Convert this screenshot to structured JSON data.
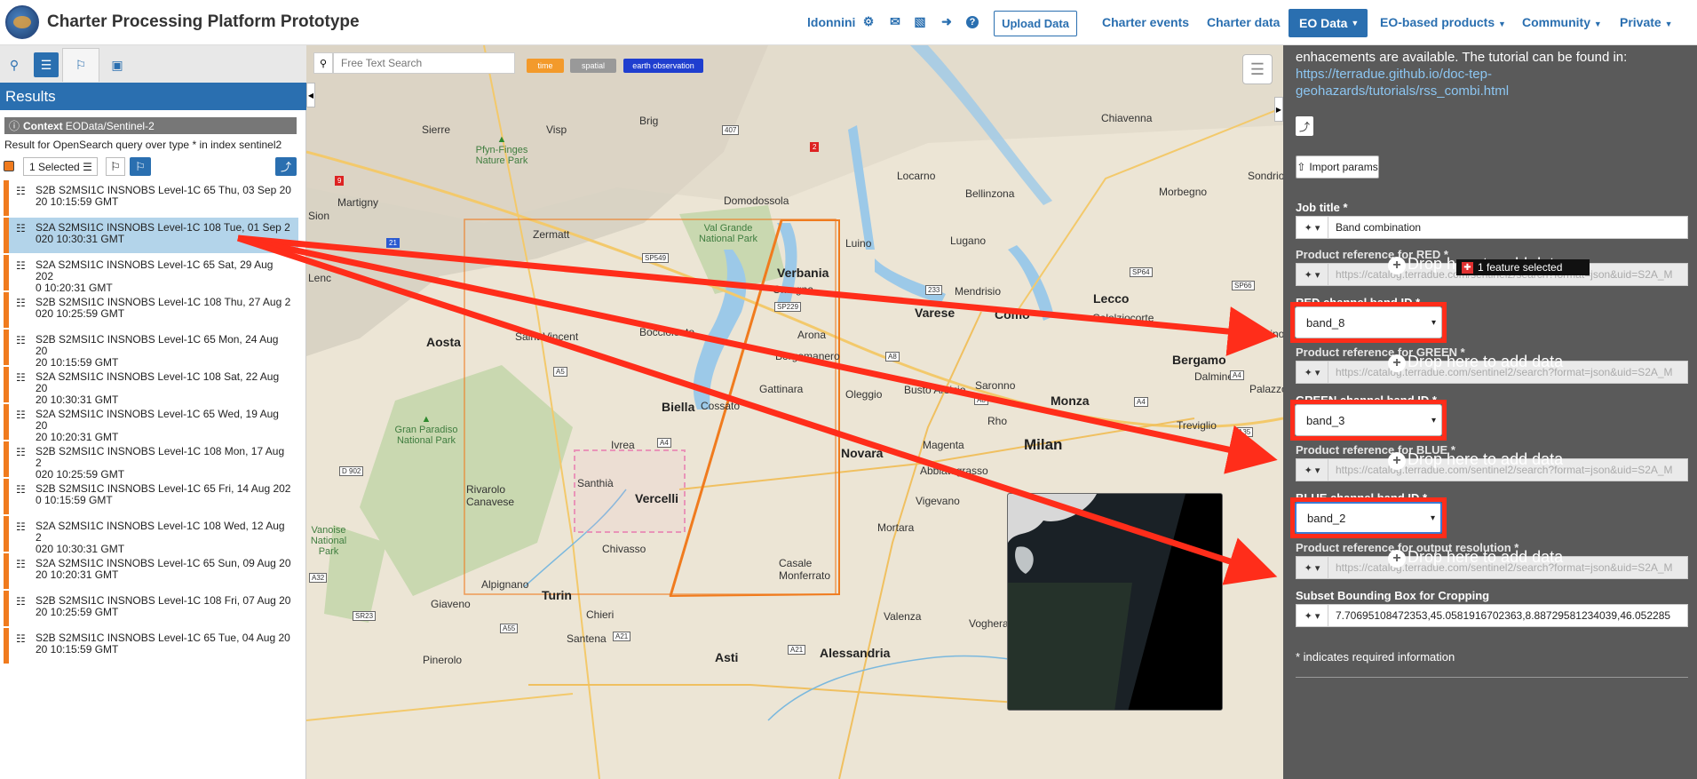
{
  "app": {
    "title": "Charter Processing Platform Prototype"
  },
  "topnav": {
    "username": "ldonnini",
    "upload_label": "Upload Data",
    "links": [
      "Charter events",
      "Charter data",
      "EO Data",
      "EO-based products",
      "Community",
      "Private"
    ],
    "active": "EO Data"
  },
  "left": {
    "results_title": "Results",
    "context_label": "Context",
    "context_value": "EOData/Sentinel-2",
    "query_text": "Result for OpenSearch query over type * in index sentinel2",
    "selected_label": "1 Selected",
    "items": [
      {
        "line1": "S2B S2MSI1C INSNOBS Level-1C 65 Thu, 03 Sep 20",
        "line2": "20 10:15:59 GMT"
      },
      {
        "line1": "S2A S2MSI1C INSNOBS Level-1C 108 Tue, 01 Sep 2",
        "line2": "020 10:30:31 GMT"
      },
      {
        "line1": "S2A S2MSI1C INSNOBS Level-1C 65 Sat, 29 Aug 202",
        "line2": "0 10:20:31 GMT"
      },
      {
        "line1": "S2B S2MSI1C INSNOBS Level-1C 108 Thu, 27 Aug 2",
        "line2": "020 10:25:59 GMT"
      },
      {
        "line1": "S2B S2MSI1C INSNOBS Level-1C 65 Mon, 24 Aug 20",
        "line2": "20 10:15:59 GMT"
      },
      {
        "line1": "S2A S2MSI1C INSNOBS Level-1C 108 Sat, 22 Aug 20",
        "line2": "20 10:30:31 GMT"
      },
      {
        "line1": "S2A S2MSI1C INSNOBS Level-1C 65 Wed, 19 Aug 20",
        "line2": "20 10:20:31 GMT"
      },
      {
        "line1": "S2B S2MSI1C INSNOBS Level-1C 108 Mon, 17 Aug 2",
        "line2": "020 10:25:59 GMT"
      },
      {
        "line1": "S2B S2MSI1C INSNOBS Level-1C 65 Fri, 14 Aug 202",
        "line2": "0 10:15:59 GMT"
      },
      {
        "line1": "S2A S2MSI1C INSNOBS Level-1C 108 Wed, 12 Aug 2",
        "line2": "020 10:30:31 GMT"
      },
      {
        "line1": "S2A S2MSI1C INSNOBS Level-1C 65 Sun, 09 Aug 20",
        "line2": "20 10:20:31 GMT"
      },
      {
        "line1": "S2B S2MSI1C INSNOBS Level-1C 108 Fri, 07 Aug 20",
        "line2": "20 10:25:59 GMT"
      },
      {
        "line1": "S2B S2MSI1C INSNOBS Level-1C 65 Tue, 04 Aug 20",
        "line2": "20 10:15:59 GMT"
      }
    ]
  },
  "map": {
    "search_placeholder": "Free Text Search",
    "chips": [
      "time",
      "spatial",
      "earth observation"
    ],
    "places": [
      "Brig",
      "Sierre",
      "Visp",
      "Locarno",
      "Bellinzona",
      "Chiavenna",
      "Sondrio",
      "Morbegno",
      "Domodossola",
      "Martigny",
      "Zermatt",
      "Luino",
      "Lugano",
      "Verbania",
      "Omegna",
      "Mendrisio",
      "Varese",
      "Como",
      "Lecco",
      "Calolziocorte",
      "Bocciolento",
      "Arona",
      "Albino",
      "Aosta",
      "Saint-Vincent",
      "Borgomanero",
      "Oleggio",
      "Busto Arsizio",
      "Saronno",
      "Monza",
      "Bergamo",
      "Dalmine",
      "Palazzo",
      "Gattinara",
      "Treviglio",
      "Biella",
      "Cossato",
      "Rho",
      "Milan",
      "Ivrea",
      "Novara",
      "Magenta",
      "Santhià",
      "Vercelli",
      "Abbiategrasso",
      "Vigevano",
      "Rivarolo Canavese",
      "Chivasso",
      "Mortara",
      "Casale Monferrato",
      "Turin",
      "Alpignano",
      "Giaveno",
      "Chieri",
      "Santena",
      "Valenza",
      "Voghera",
      "Alessandria",
      "Pinerolo",
      "Asti",
      "Sion",
      "Lenc"
    ],
    "parks": [
      "Pfyn-Finges Nature Park",
      "Val Grande National Park",
      "Gran Paradiso National Park",
      "Vanoise National Park"
    ],
    "road_signs": [
      "407",
      "9",
      "2",
      "21",
      "SP549",
      "SP229",
      "233",
      "SP64",
      "SP66",
      "A8",
      "A5",
      "A4",
      "A4",
      "A4",
      "A35",
      "D 902",
      "A32",
      "SR23",
      "A55",
      "A21",
      "A21",
      "A8"
    ]
  },
  "right": {
    "intro_text": "enhacements are available. The tutorial can be found in:",
    "tutorial_link": "https://terradue.github.io/doc-tep-geohazards/tutorials/rss_combi.html",
    "import_label": "Import params",
    "job_title_label": "Job title *",
    "job_title_value": "Band combination",
    "fields": [
      {
        "label": "Product reference for RED *",
        "placeholder": "https://catalog.terradue.com/sentinel2/search?format=json&uid=S2A_M",
        "drop": "Drop here to add data"
      },
      {
        "label": "Product reference for GREEN *",
        "placeholder": "https://catalog.terradue.com/sentinel2/search?format=json&uid=S2A_M",
        "drop": "Drop here to add data"
      },
      {
        "label": "Product reference for BLUE *",
        "placeholder": "https://catalog.terradue.com/sentinel2/search?format=json&uid=S2A_M",
        "drop": "Drop here to add data"
      },
      {
        "label": "Product reference for output resolution *",
        "placeholder": "https://catalog.terradue.com/sentinel2/search?format=json&uid=S2A_M",
        "drop": "Drop here to add data"
      }
    ],
    "red_band_label": "RED channel band ID *",
    "red_band_value": "band_8",
    "green_band_label": "GREEN channel band ID *",
    "green_band_value": "band_3",
    "blue_band_label": "BLUE channel band ID *",
    "blue_band_value": "band_2",
    "bbox_label": "Subset Bounding Box for Cropping",
    "bbox_value": "7.70695108472353,45.0581916702363,8.88729581234039,46.052285",
    "feature_badge": "1 feature selected",
    "required_note": "* indicates required information"
  },
  "colors": {
    "accent": "#2a6fb0",
    "orange": "#f07b1e",
    "arrow": "#ff2d1a",
    "panel": "#5a5a5a"
  }
}
